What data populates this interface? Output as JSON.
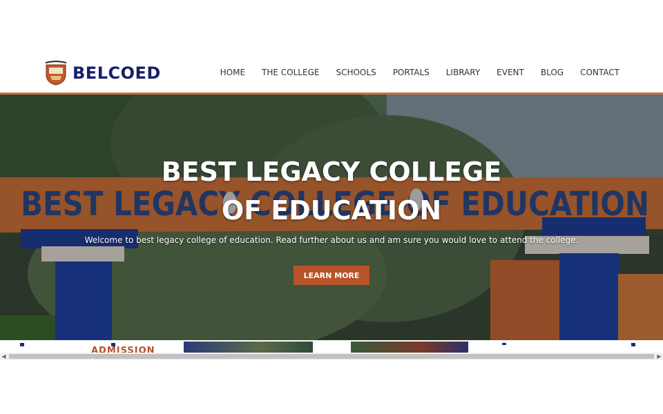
{
  "brand": {
    "name": "BELCOED",
    "crest_icon": "college-crest-icon"
  },
  "nav": {
    "items": [
      {
        "label": "HOME"
      },
      {
        "label": "THE COLLEGE"
      },
      {
        "label": "SCHOOLS"
      },
      {
        "label": "PORTALS"
      },
      {
        "label": "LIBRARY"
      },
      {
        "label": "EVENT"
      },
      {
        "label": "BLOG"
      },
      {
        "label": "CONTACT"
      }
    ]
  },
  "hero": {
    "title": "BEST LEGACY COLLEGE OF EDUCATION",
    "subtitle": "Welcome to best legacy college of education. Read further about us and am sure you would love to attend the college.",
    "button_label": "LEARN MORE",
    "gate_sign_text": "BEST LEGACY COLLEGE OF EDUCATION"
  },
  "strip": {
    "admission_label": "ADMISSION"
  },
  "colors": {
    "brand_navy": "#16206b",
    "accent_orange": "#c7763d",
    "button_rust": "#b7532a"
  }
}
